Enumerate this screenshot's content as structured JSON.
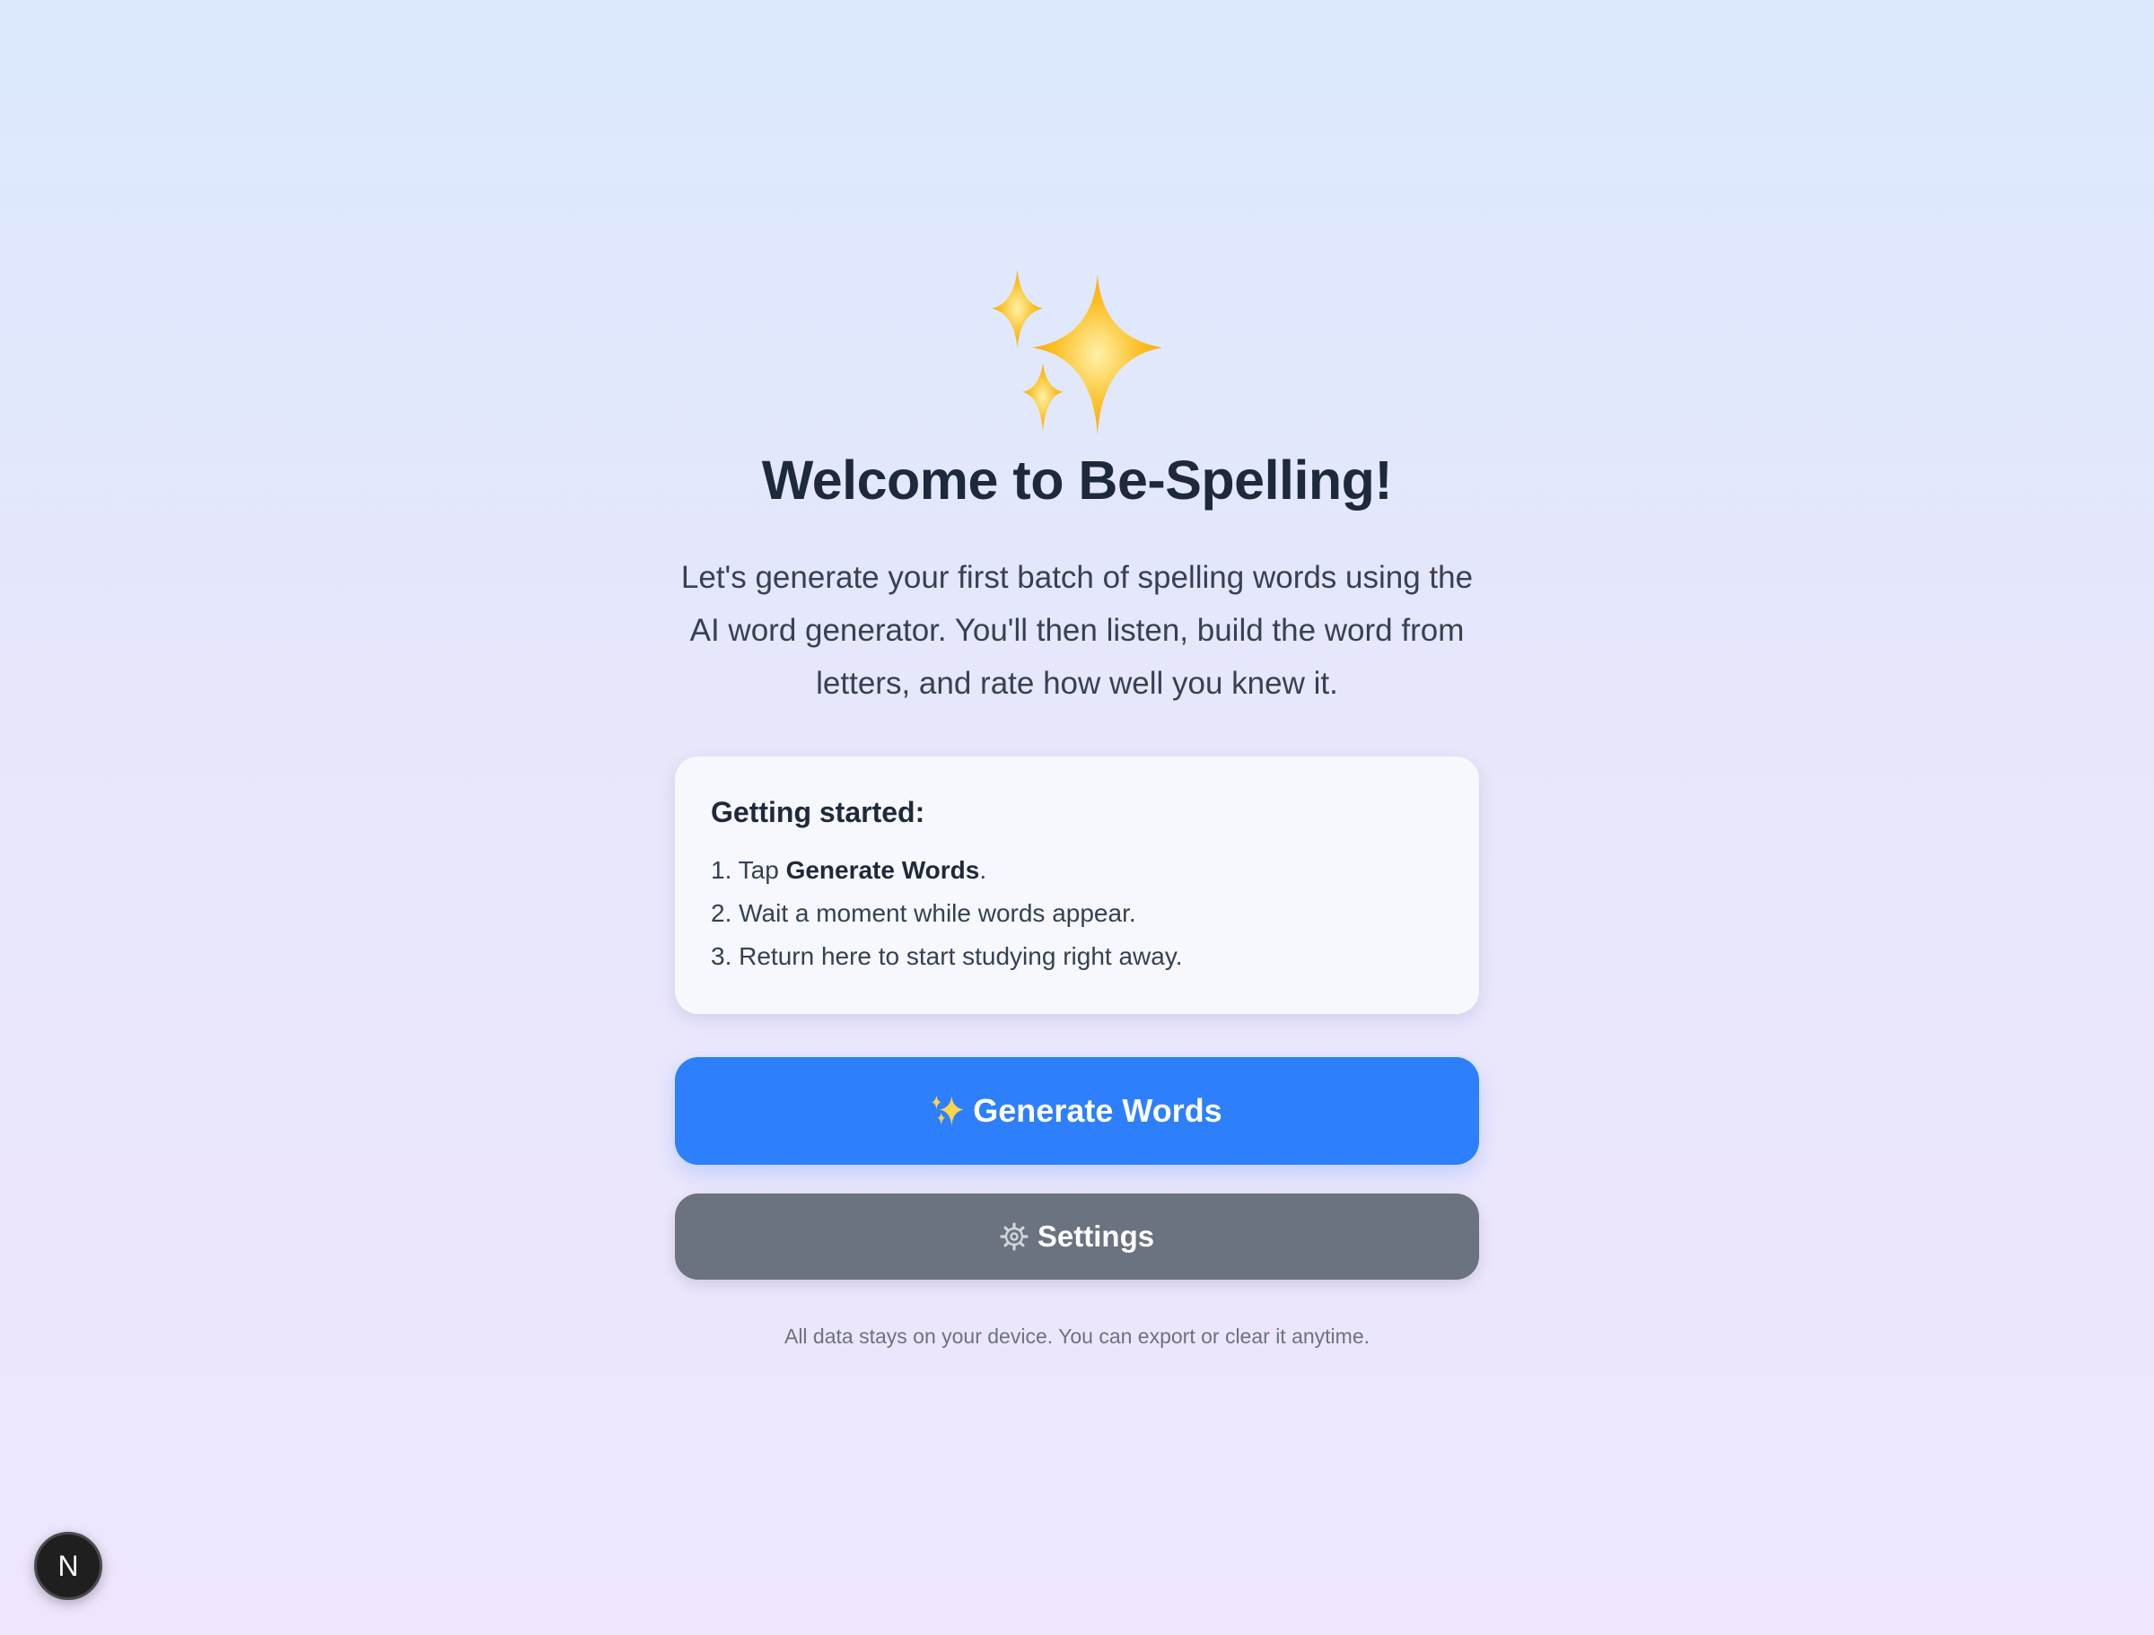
{
  "hero": {
    "icon": "sparkles-icon",
    "title": "Welcome to Be-Spelling!",
    "intro": "Let's generate your first batch of spelling words using the AI word generator. You'll then listen, build the word from letters, and rate how well you knew it."
  },
  "getting_started": {
    "heading": "Getting started:",
    "steps": [
      {
        "prefix": "1. Tap ",
        "bold": "Generate Words",
        "suffix": "."
      },
      {
        "text": "2. Wait a moment while words appear."
      },
      {
        "text": "3. Return here to start studying right away."
      }
    ]
  },
  "actions": {
    "generate_label": "Generate Words",
    "generate_icon": "sparkles-icon",
    "settings_label": "Settings",
    "settings_icon": "gear-icon"
  },
  "footer": {
    "note": "All data stays on your device. You can export or clear it anytime."
  },
  "dev_badge": {
    "letter": "N"
  },
  "colors": {
    "primary": "#2d7ffb",
    "secondary": "#6b7280",
    "heading": "#1e293b",
    "sparkle": "#fbbf24"
  }
}
